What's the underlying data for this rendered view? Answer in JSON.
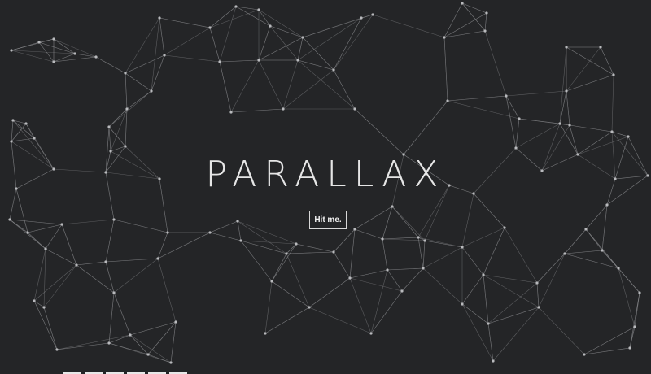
{
  "hero": {
    "title": "PARALLAX",
    "button_label": "Hit me."
  },
  "colors": {
    "background": "#242527",
    "lines": "#8a8b8e",
    "nodes": "#b9babd",
    "title": "#e6e6e6"
  },
  "thumbnails": {
    "count": 6
  }
}
